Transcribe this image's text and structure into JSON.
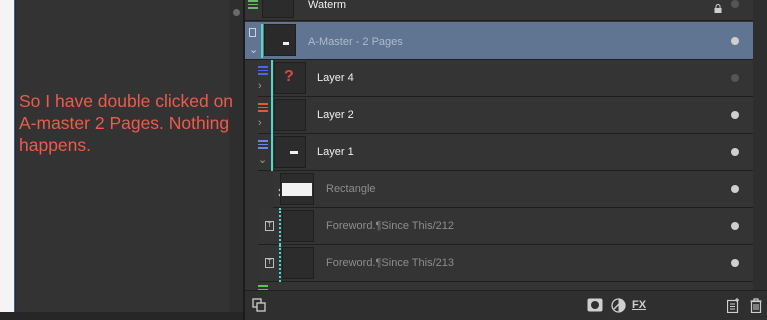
{
  "annotation": "So I have double clicked on A-master 2 Pages. Nothing happens.",
  "layers": [
    {
      "name": "Waterm",
      "state": "locked-partial"
    },
    {
      "name": "A-Master - 2 Pages",
      "state": "selected"
    },
    {
      "name": "Layer 4",
      "state": "normal"
    },
    {
      "name": "Layer 2",
      "state": "normal"
    },
    {
      "name": "Layer 1",
      "state": "normal"
    },
    {
      "name": "Rectangle",
      "state": "dim"
    },
    {
      "name": "Foreword.¶Since This/212",
      "state": "dim"
    },
    {
      "name": "Foreword.¶Since This/213",
      "state": "dim"
    }
  ],
  "toolbar": {
    "fx_label": "FX"
  },
  "colors": {
    "annotation": "#ef5a4a",
    "selection": "#5f7591",
    "accent_line": "#55d6c2",
    "layer4_icon": "#d84848"
  }
}
